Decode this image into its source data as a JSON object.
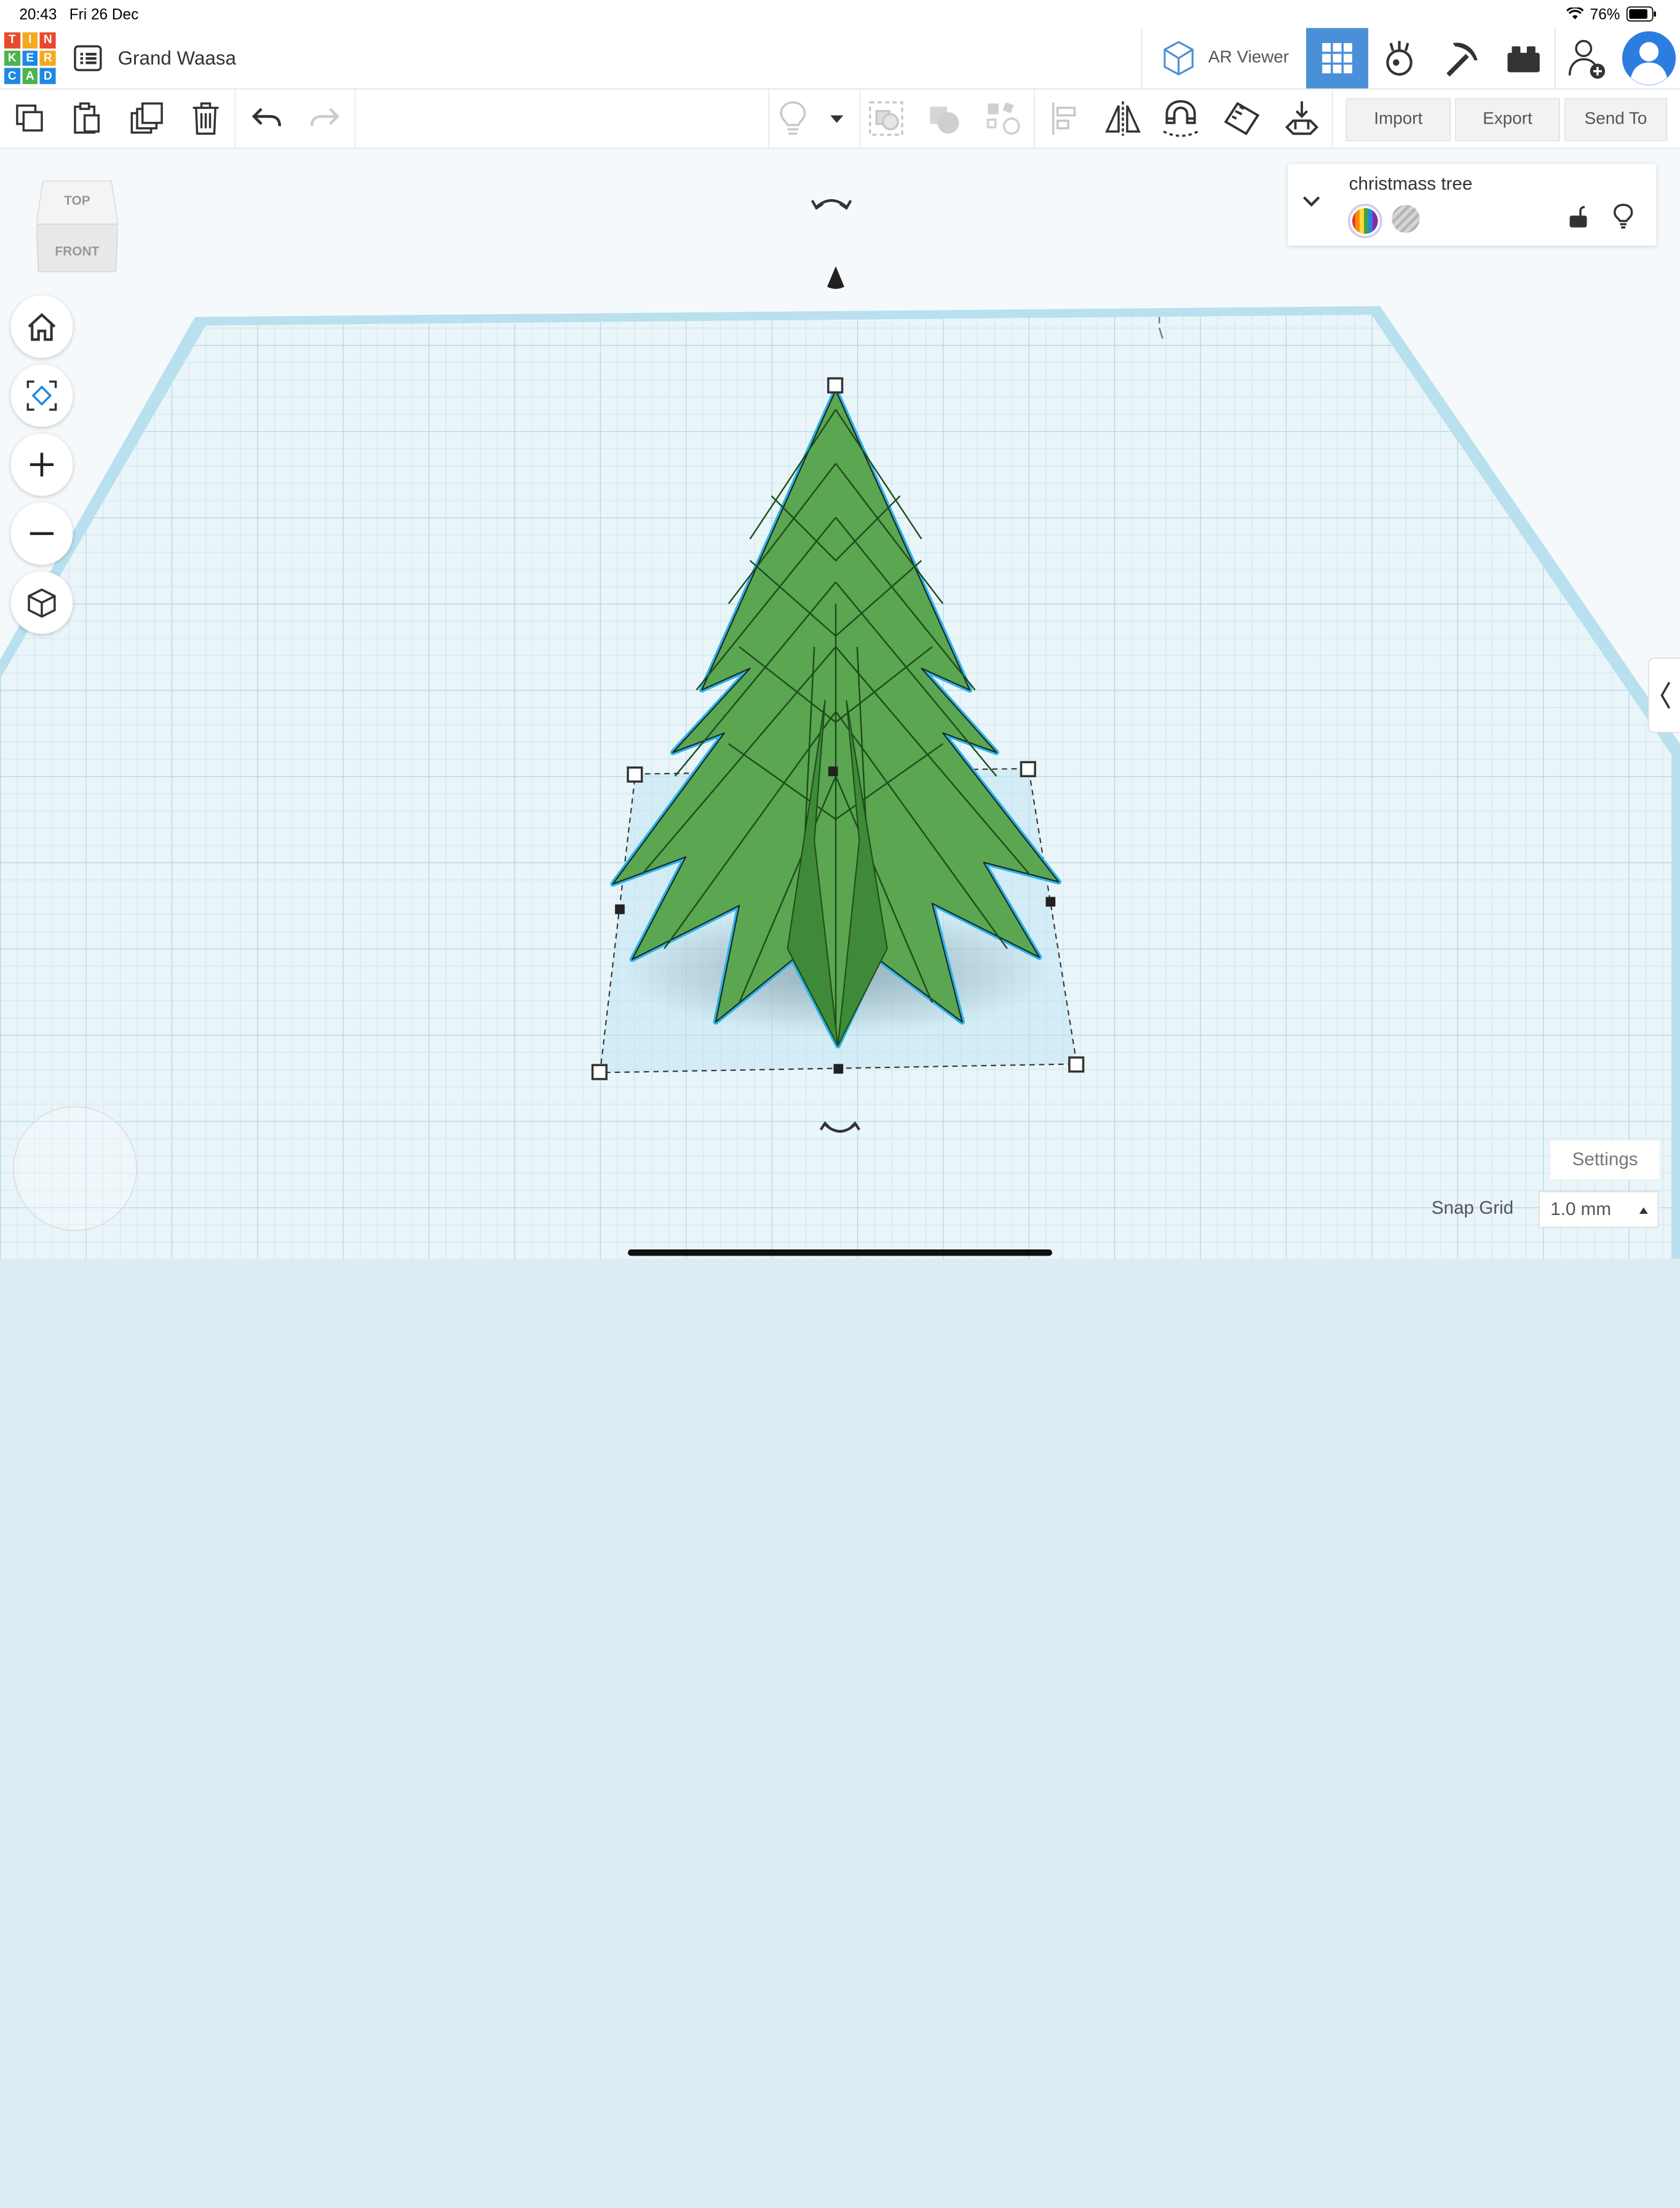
{
  "status_bar": {
    "time": "20:43",
    "date": "Fri 26 Dec",
    "battery": "76%"
  },
  "header": {
    "logo_letters": [
      "T",
      "I",
      "N",
      "K",
      "E",
      "R",
      "C",
      "A",
      "D"
    ],
    "design_title": "Grand Waasa",
    "ar_viewer_label": "AR Viewer"
  },
  "toolbar": {
    "import_label": "Import",
    "export_label": "Export",
    "send_to_label": "Send To"
  },
  "viewcube": {
    "top": "TOP",
    "front": "FRONT"
  },
  "inspector": {
    "shape_name": "christmass tree"
  },
  "bottom": {
    "settings_label": "Settings",
    "snap_grid_label": "Snap Grid",
    "snap_grid_value": "1.0 mm"
  },
  "colors": {
    "accent": "#4a90d9",
    "tree": "#4f9a46",
    "outline": "#29b6e8",
    "grid": "#c6e2ec"
  }
}
